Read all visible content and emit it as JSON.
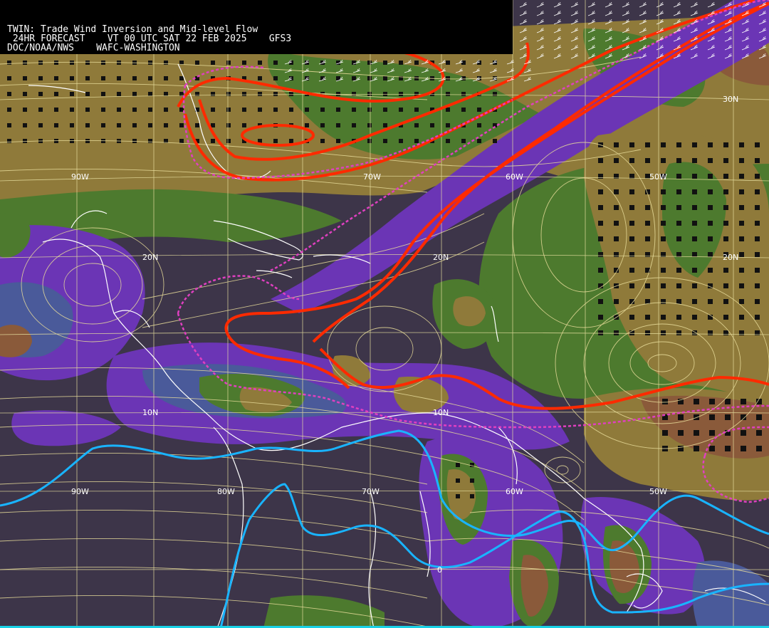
{
  "header": {
    "line1": "TWIN: Trade Wind Inversion and Mid-level Flow",
    "line2": " 24HR FORECAST    VT 00 UTC SAT 22 FEB 2025    GFS3",
    "line3": "DOC/NOAA/NWS    WAFC-WASHINGTON"
  },
  "grid_labels": {
    "lon_top": [
      "90W",
      "70W",
      "60W",
      "50W"
    ],
    "lon_bottom": [
      "90W",
      "80W",
      "70W",
      "60W",
      "50W"
    ],
    "lat_left": [
      "20N",
      "10N"
    ],
    "lat_mid": [
      "20N",
      "10N"
    ],
    "lat_right": [
      "30N",
      "20N"
    ],
    "equator": "0"
  },
  "colors": {
    "ocean_dark": "#3d3549",
    "purple": "#6b35b5",
    "blue": "#4a5a9a",
    "green": "#4d7a2e",
    "olive": "#8f7a3a",
    "brown": "#8a5a3a",
    "red_contour": "#e02020",
    "pink_dashed": "#e040c0",
    "cyan_line": "#19b4ff",
    "coast": "#ffffff",
    "grid": "#e8e0a0",
    "streamline": "#e8dc9a"
  }
}
